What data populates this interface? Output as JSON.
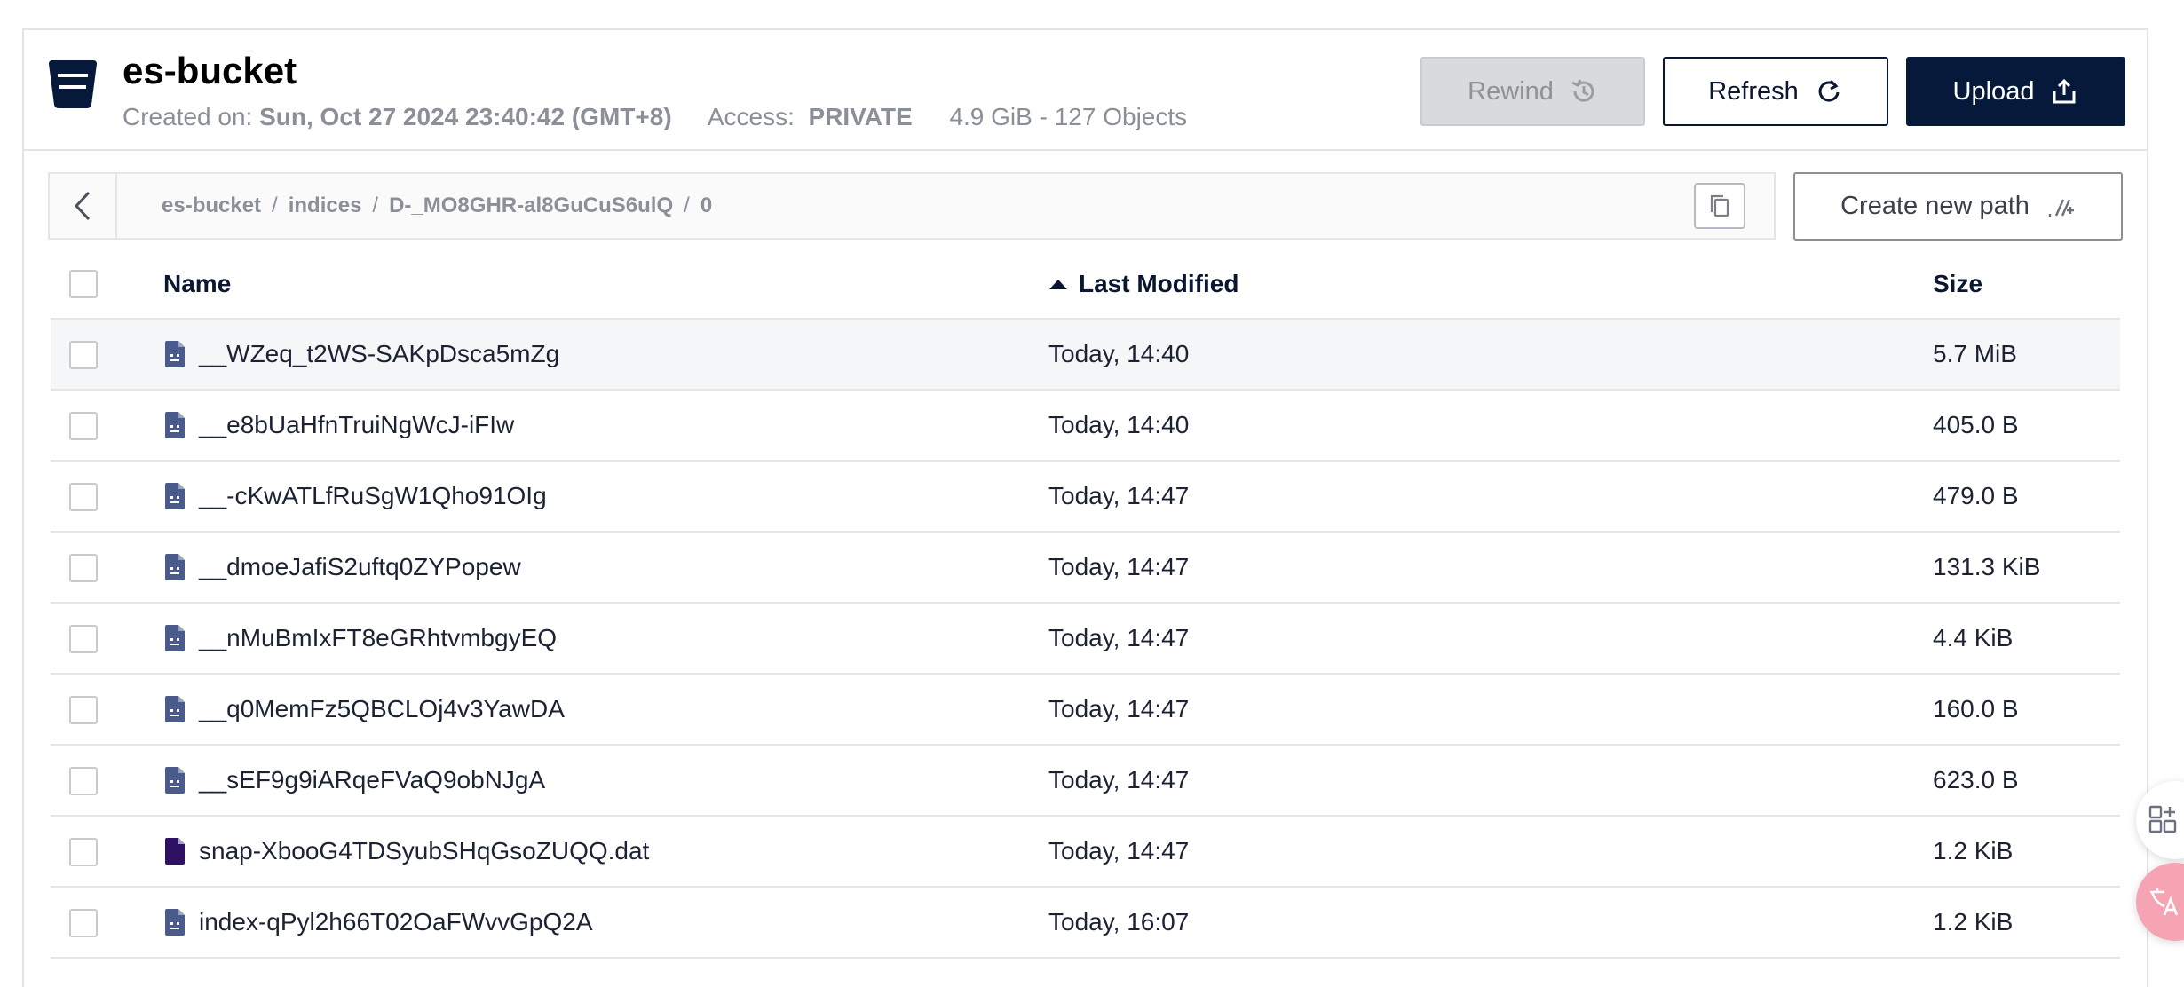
{
  "bucket": {
    "name": "es-bucket",
    "created_label": "Created on:",
    "created_value": "Sun, Oct 27 2024 23:40:42 (GMT+8)",
    "access_label": "Access:",
    "access_value": "PRIVATE",
    "usage": "4.9 GiB - 127 Objects"
  },
  "toolbar": {
    "rewind_label": "Rewind",
    "refresh_label": "Refresh",
    "upload_label": "Upload"
  },
  "breadcrumb": [
    "es-bucket",
    "indices",
    "D-_MO8GHR-al8GuCuS6ulQ",
    "0"
  ],
  "create_path_label": "Create new path",
  "table": {
    "columns": {
      "name": "Name",
      "modified": "Last Modified",
      "size": "Size"
    },
    "sort_column": "Last Modified",
    "rows": [
      {
        "name": "__WZeq_t2WS-SAKpDsca5mZg",
        "modified": "Today, 14:40",
        "size": "5.7 MiB",
        "icon": "file-icon"
      },
      {
        "name": "__e8bUaHfnTruiNgWcJ-iFIw",
        "modified": "Today, 14:40",
        "size": "405.0 B",
        "icon": "file-icon"
      },
      {
        "name": "__-cKwATLfRuSgW1Qho91OIg",
        "modified": "Today, 14:47",
        "size": "479.0 B",
        "icon": "file-icon"
      },
      {
        "name": "__dmoeJafiS2uftq0ZYPopew",
        "modified": "Today, 14:47",
        "size": "131.3 KiB",
        "icon": "file-icon"
      },
      {
        "name": "__nMuBmIxFT8eGRhtvmbgyEQ",
        "modified": "Today, 14:47",
        "size": "4.4 KiB",
        "icon": "file-icon"
      },
      {
        "name": "__q0MemFz5QBCLOj4v3YawDA",
        "modified": "Today, 14:47",
        "size": "160.0 B",
        "icon": "file-icon"
      },
      {
        "name": "__sEF9g9iARqeFVaQ9obNJgA",
        "modified": "Today, 14:47",
        "size": "623.0 B",
        "icon": "file-icon"
      },
      {
        "name": "snap-XbooG4TDSyubSHqGsoZUQQ.dat",
        "modified": "Today, 14:47",
        "size": "1.2 KiB",
        "icon": "dat-file-icon"
      },
      {
        "name": "index-qPyl2h66T02OaFWvvGpQ2A",
        "modified": "Today, 16:07",
        "size": "1.2 KiB",
        "icon": "file-icon"
      }
    ]
  },
  "colors": {
    "primary": "#07193a",
    "file_icon": "#4a5a8a",
    "dat_icon": "#2e1065",
    "muted": "#8a8f98"
  }
}
